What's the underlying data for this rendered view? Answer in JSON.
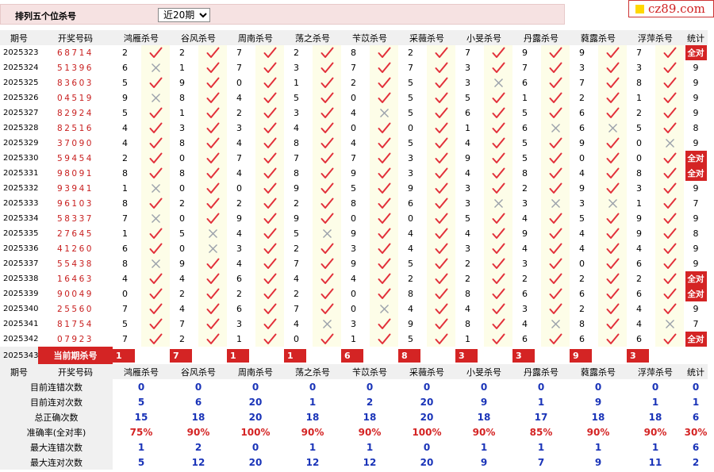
{
  "header": {
    "title": "排列五个位杀号",
    "period_select": "近20期"
  },
  "logo": {
    "text": "cz89.com"
  },
  "columns": [
    "期号",
    "开奖号码",
    "鸿雁杀号",
    "谷风杀号",
    "周南杀号",
    "荡之杀号",
    "苄苡杀号",
    "采薇杀号",
    "小旻杀号",
    "丹露杀号",
    "蕤露杀号",
    "浮萍杀号",
    "统计"
  ],
  "experts": [
    "鸿雁杀号",
    "谷风杀号",
    "周南杀号",
    "荡之杀号",
    "苄苡杀号",
    "采薇杀号",
    "小旻杀号",
    "丹露杀号",
    "蕤露杀号",
    "浮萍杀号"
  ],
  "rows": [
    {
      "period": "2025323",
      "numbers": "68714",
      "kills": [
        [
          "2",
          1
        ],
        [
          "2",
          1
        ],
        [
          "7",
          1
        ],
        [
          "2",
          1
        ],
        [
          "8",
          1
        ],
        [
          "2",
          1
        ],
        [
          "7",
          1
        ],
        [
          "9",
          1
        ],
        [
          "9",
          1
        ],
        [
          "7",
          1
        ]
      ],
      "stat": "全对"
    },
    {
      "period": "2025324",
      "numbers": "51396",
      "kills": [
        [
          "6",
          0
        ],
        [
          "1",
          1
        ],
        [
          "7",
          1
        ],
        [
          "3",
          1
        ],
        [
          "7",
          1
        ],
        [
          "7",
          1
        ],
        [
          "3",
          1
        ],
        [
          "7",
          1
        ],
        [
          "3",
          1
        ],
        [
          "3",
          1
        ]
      ],
      "stat": "9"
    },
    {
      "period": "2025325",
      "numbers": "83603",
      "kills": [
        [
          "5",
          1
        ],
        [
          "9",
          1
        ],
        [
          "0",
          1
        ],
        [
          "1",
          1
        ],
        [
          "2",
          1
        ],
        [
          "5",
          1
        ],
        [
          "3",
          0
        ],
        [
          "6",
          1
        ],
        [
          "7",
          1
        ],
        [
          "8",
          1
        ]
      ],
      "stat": "9"
    },
    {
      "period": "2025326",
      "numbers": "04519",
      "kills": [
        [
          "9",
          0
        ],
        [
          "8",
          1
        ],
        [
          "4",
          1
        ],
        [
          "5",
          1
        ],
        [
          "0",
          1
        ],
        [
          "5",
          1
        ],
        [
          "5",
          1
        ],
        [
          "1",
          1
        ],
        [
          "2",
          1
        ],
        [
          "1",
          1
        ]
      ],
      "stat": "9"
    },
    {
      "period": "2025327",
      "numbers": "82924",
      "kills": [
        [
          "5",
          1
        ],
        [
          "1",
          1
        ],
        [
          "2",
          1
        ],
        [
          "3",
          1
        ],
        [
          "4",
          0
        ],
        [
          "5",
          1
        ],
        [
          "6",
          1
        ],
        [
          "5",
          1
        ],
        [
          "6",
          1
        ],
        [
          "2",
          1
        ]
      ],
      "stat": "9"
    },
    {
      "period": "2025328",
      "numbers": "82516",
      "kills": [
        [
          "4",
          1
        ],
        [
          "3",
          1
        ],
        [
          "3",
          1
        ],
        [
          "4",
          1
        ],
        [
          "0",
          1
        ],
        [
          "0",
          1
        ],
        [
          "1",
          1
        ],
        [
          "6",
          0
        ],
        [
          "6",
          0
        ],
        [
          "5",
          1
        ]
      ],
      "stat": "8"
    },
    {
      "period": "2025329",
      "numbers": "37090",
      "kills": [
        [
          "4",
          1
        ],
        [
          "8",
          1
        ],
        [
          "4",
          1
        ],
        [
          "8",
          1
        ],
        [
          "4",
          1
        ],
        [
          "5",
          1
        ],
        [
          "4",
          1
        ],
        [
          "5",
          1
        ],
        [
          "9",
          1
        ],
        [
          "0",
          0
        ]
      ],
      "stat": "9"
    },
    {
      "period": "2025330",
      "numbers": "59454",
      "kills": [
        [
          "2",
          1
        ],
        [
          "0",
          1
        ],
        [
          "7",
          1
        ],
        [
          "7",
          1
        ],
        [
          "7",
          1
        ],
        [
          "3",
          1
        ],
        [
          "9",
          1
        ],
        [
          "5",
          1
        ],
        [
          "0",
          1
        ],
        [
          "0",
          1
        ]
      ],
      "stat": "全对"
    },
    {
      "period": "2025331",
      "numbers": "98091",
      "kills": [
        [
          "8",
          1
        ],
        [
          "8",
          1
        ],
        [
          "4",
          1
        ],
        [
          "8",
          1
        ],
        [
          "9",
          1
        ],
        [
          "3",
          1
        ],
        [
          "4",
          1
        ],
        [
          "8",
          1
        ],
        [
          "4",
          1
        ],
        [
          "8",
          1
        ]
      ],
      "stat": "全对"
    },
    {
      "period": "2025332",
      "numbers": "93941",
      "kills": [
        [
          "1",
          0
        ],
        [
          "0",
          1
        ],
        [
          "0",
          1
        ],
        [
          "9",
          1
        ],
        [
          "5",
          1
        ],
        [
          "9",
          1
        ],
        [
          "3",
          1
        ],
        [
          "2",
          1
        ],
        [
          "9",
          1
        ],
        [
          "3",
          1
        ]
      ],
      "stat": "9"
    },
    {
      "period": "2025333",
      "numbers": "96103",
      "kills": [
        [
          "8",
          1
        ],
        [
          "2",
          1
        ],
        [
          "2",
          1
        ],
        [
          "2",
          1
        ],
        [
          "8",
          1
        ],
        [
          "6",
          1
        ],
        [
          "3",
          0
        ],
        [
          "3",
          0
        ],
        [
          "3",
          0
        ],
        [
          "1",
          1
        ]
      ],
      "stat": "7"
    },
    {
      "period": "2025334",
      "numbers": "58337",
      "kills": [
        [
          "7",
          0
        ],
        [
          "0",
          1
        ],
        [
          "9",
          1
        ],
        [
          "9",
          1
        ],
        [
          "0",
          1
        ],
        [
          "0",
          1
        ],
        [
          "5",
          1
        ],
        [
          "4",
          1
        ],
        [
          "5",
          1
        ],
        [
          "9",
          1
        ]
      ],
      "stat": "9"
    },
    {
      "period": "2025335",
      "numbers": "27645",
      "kills": [
        [
          "1",
          1
        ],
        [
          "5",
          0
        ],
        [
          "4",
          1
        ],
        [
          "5",
          0
        ],
        [
          "9",
          1
        ],
        [
          "4",
          1
        ],
        [
          "4",
          1
        ],
        [
          "9",
          1
        ],
        [
          "4",
          1
        ],
        [
          "9",
          1
        ]
      ],
      "stat": "8"
    },
    {
      "period": "2025336",
      "numbers": "41260",
      "kills": [
        [
          "6",
          1
        ],
        [
          "0",
          0
        ],
        [
          "3",
          1
        ],
        [
          "2",
          1
        ],
        [
          "3",
          1
        ],
        [
          "4",
          1
        ],
        [
          "3",
          1
        ],
        [
          "4",
          1
        ],
        [
          "4",
          1
        ],
        [
          "4",
          1
        ]
      ],
      "stat": "9"
    },
    {
      "period": "2025337",
      "numbers": "55438",
      "kills": [
        [
          "8",
          0
        ],
        [
          "9",
          1
        ],
        [
          "4",
          1
        ],
        [
          "7",
          1
        ],
        [
          "9",
          1
        ],
        [
          "5",
          1
        ],
        [
          "2",
          1
        ],
        [
          "3",
          1
        ],
        [
          "0",
          1
        ],
        [
          "6",
          1
        ]
      ],
      "stat": "9"
    },
    {
      "period": "2025338",
      "numbers": "16463",
      "kills": [
        [
          "4",
          1
        ],
        [
          "4",
          1
        ],
        [
          "6",
          1
        ],
        [
          "4",
          1
        ],
        [
          "4",
          1
        ],
        [
          "2",
          1
        ],
        [
          "2",
          1
        ],
        [
          "2",
          1
        ],
        [
          "2",
          1
        ],
        [
          "2",
          1
        ]
      ],
      "stat": "全对"
    },
    {
      "period": "2025339",
      "numbers": "90049",
      "kills": [
        [
          "0",
          1
        ],
        [
          "2",
          1
        ],
        [
          "2",
          1
        ],
        [
          "2",
          1
        ],
        [
          "0",
          1
        ],
        [
          "8",
          1
        ],
        [
          "8",
          1
        ],
        [
          "6",
          1
        ],
        [
          "6",
          1
        ],
        [
          "6",
          1
        ]
      ],
      "stat": "全对"
    },
    {
      "period": "2025340",
      "numbers": "25560",
      "kills": [
        [
          "7",
          1
        ],
        [
          "4",
          1
        ],
        [
          "6",
          1
        ],
        [
          "7",
          1
        ],
        [
          "0",
          0
        ],
        [
          "4",
          1
        ],
        [
          "4",
          1
        ],
        [
          "3",
          1
        ],
        [
          "2",
          1
        ],
        [
          "4",
          1
        ]
      ],
      "stat": "9"
    },
    {
      "period": "2025341",
      "numbers": "81754",
      "kills": [
        [
          "5",
          1
        ],
        [
          "7",
          1
        ],
        [
          "3",
          1
        ],
        [
          "4",
          0
        ],
        [
          "3",
          1
        ],
        [
          "9",
          1
        ],
        [
          "8",
          1
        ],
        [
          "4",
          0
        ],
        [
          "8",
          1
        ],
        [
          "4",
          0
        ]
      ],
      "stat": "7"
    },
    {
      "period": "2025342",
      "numbers": "07923",
      "kills": [
        [
          "7",
          1
        ],
        [
          "2",
          1
        ],
        [
          "1",
          1
        ],
        [
          "0",
          1
        ],
        [
          "1",
          1
        ],
        [
          "5",
          1
        ],
        [
          "1",
          1
        ],
        [
          "6",
          1
        ],
        [
          "6",
          1
        ],
        [
          "6",
          1
        ]
      ],
      "stat": "全对"
    }
  ],
  "current": {
    "period": "2025343",
    "label": "当前期杀号",
    "kills": [
      "1",
      "7",
      "1",
      "1",
      "6",
      "8",
      "3",
      "3",
      "9",
      "3"
    ]
  },
  "summary": [
    {
      "label": "目前连错次数",
      "values": [
        "0",
        "0",
        "0",
        "0",
        "0",
        "0",
        "0",
        "0",
        "0",
        "0",
        "0"
      ],
      "pct": false
    },
    {
      "label": "目前连对次数",
      "values": [
        "5",
        "6",
        "20",
        "1",
        "2",
        "20",
        "9",
        "1",
        "9",
        "1",
        "1"
      ],
      "pct": false
    },
    {
      "label": "总正确次数",
      "values": [
        "15",
        "18",
        "20",
        "18",
        "18",
        "20",
        "18",
        "17",
        "18",
        "18",
        "6"
      ],
      "pct": false
    },
    {
      "label": "准确率(全对率)",
      "values": [
        "75%",
        "90%",
        "100%",
        "90%",
        "90%",
        "100%",
        "90%",
        "85%",
        "90%",
        "90%",
        "30%"
      ],
      "pct": true
    },
    {
      "label": "最大连错次数",
      "values": [
        "1",
        "2",
        "0",
        "1",
        "1",
        "0",
        "1",
        "1",
        "1",
        "1",
        "6"
      ],
      "pct": false
    },
    {
      "label": "最大连对次数",
      "values": [
        "5",
        "12",
        "20",
        "12",
        "12",
        "20",
        "9",
        "7",
        "9",
        "11",
        "2"
      ],
      "pct": false
    }
  ],
  "colors": {
    "accent_red": "#d42424",
    "number_red": "#c81e1e",
    "summary_blue": "#1a34b8",
    "header_gray": "#f0f0f0",
    "status_cell_yellow": "#fdfde8",
    "topbar_pink": "#f6e2e2"
  },
  "icons": {
    "correct": "check-icon",
    "wrong": "cross-icon"
  }
}
